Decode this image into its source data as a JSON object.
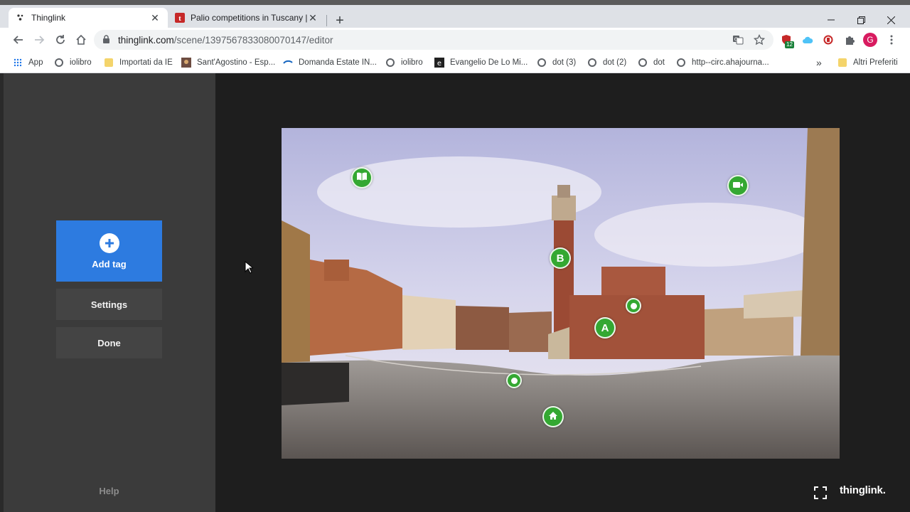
{
  "browser": {
    "tabs": [
      {
        "title": "Thinglink",
        "active": true
      },
      {
        "title": "Palio competitions in Tuscany | V",
        "active": false
      }
    ],
    "url_host": "thinglink.com",
    "url_path": "/scene/1397567833080070147/editor",
    "extension_badge": "12",
    "profile_initial": "G",
    "bookmarks": [
      {
        "label": "App",
        "icon": "apps-grid-icon"
      },
      {
        "label": "iolibro",
        "icon": "globe-icon"
      },
      {
        "label": "Importati da IE",
        "icon": "folder-icon"
      },
      {
        "label": "Sant'Agostino - Esp...",
        "icon": "painting-icon"
      },
      {
        "label": "Domanda Estate IN...",
        "icon": "swoosh-icon"
      },
      {
        "label": "iolibro",
        "icon": "globe-icon"
      },
      {
        "label": "Evangelio De Lo Mi...",
        "icon": "e-icon"
      },
      {
        "label": "dot (3)",
        "icon": "globe-icon"
      },
      {
        "label": "dot (2)",
        "icon": "globe-icon"
      },
      {
        "label": "dot",
        "icon": "globe-icon"
      },
      {
        "label": "http--circ.ahajourna...",
        "icon": "globe-icon"
      }
    ],
    "bookmarks_overflow": "»",
    "other_bookmarks": "Altri Preferiti"
  },
  "sidebar": {
    "add_tag_label": "Add tag",
    "settings_label": "Settings",
    "done_label": "Done",
    "help_label": "Help"
  },
  "scene": {
    "tags": [
      {
        "name": "tag-book",
        "kind": "icon",
        "icon": "book-icon"
      },
      {
        "name": "tag-video",
        "kind": "icon",
        "icon": "video-icon"
      },
      {
        "name": "tag-b",
        "kind": "letter",
        "label": "B"
      },
      {
        "name": "tag-a",
        "kind": "letter",
        "label": "A"
      },
      {
        "name": "tag-dot-palace",
        "kind": "dot"
      },
      {
        "name": "tag-dot-square",
        "kind": "dot"
      },
      {
        "name": "tag-home",
        "kind": "icon",
        "icon": "home-icon"
      }
    ],
    "tag_color": "#34a832"
  },
  "footer": {
    "brand": "thinglink."
  },
  "colors": {
    "accent": "#2d7be0",
    "sidebar": "#3b3b3b",
    "canvas": "#1e1e1e"
  }
}
